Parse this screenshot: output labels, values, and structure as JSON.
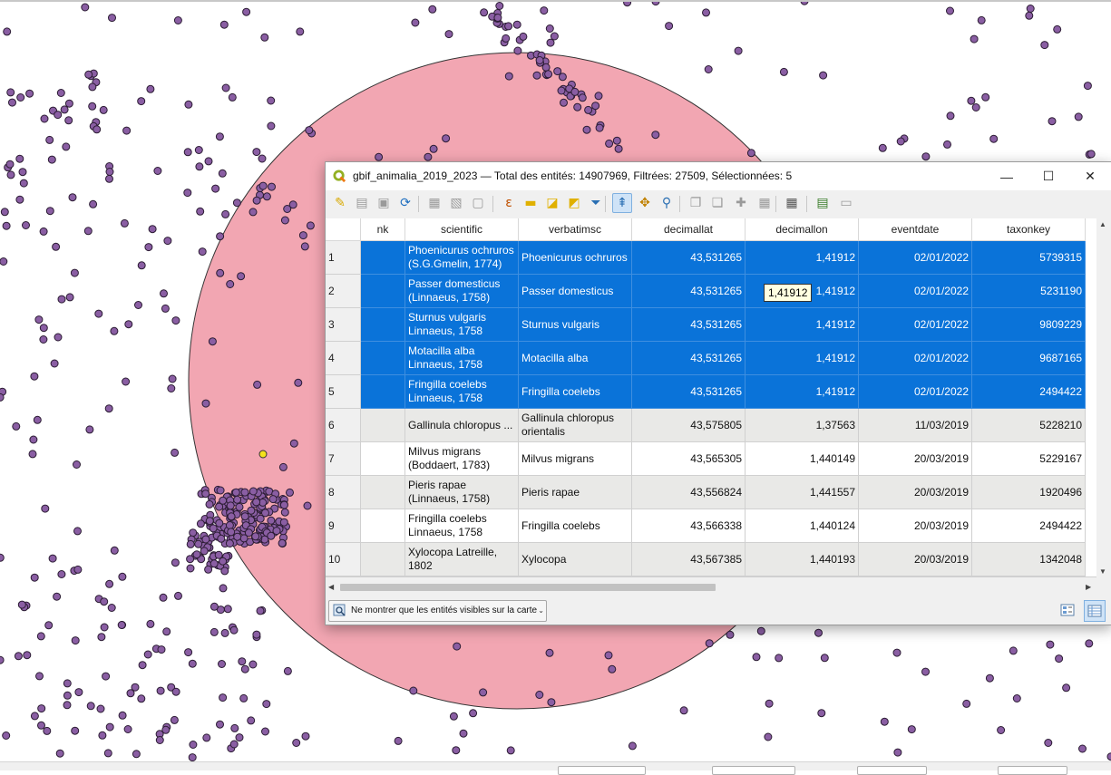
{
  "window": {
    "title": "gbif_animalia_2019_2023 — Total des entités: 14907969, Filtrées: 27509, Sélectionnées: 5",
    "minimize": "—",
    "maximize": "☐",
    "close": "✕"
  },
  "colors": {
    "selection": "#0a73d9",
    "alt_row": "#e9e9e7",
    "buffer_fill": "#f2a6b2",
    "point_fill": "#8a5ea3",
    "highlight_point": "#f4e21c"
  },
  "toolbar": {
    "items": [
      "pencil-icon",
      "toggle-multi-edit-icon",
      "save-edits-icon",
      "reload-icon",
      "add-feature-icon",
      "delete-feature-icon",
      "cut-icon",
      "expression-select-icon",
      "select-all-icon",
      "invert-selection-icon",
      "deselect-icon",
      "filter-icon",
      "move-selection-top-icon",
      "pan-to-selection-icon",
      "zoom-to-selection-icon",
      "copy-icon",
      "paste-icon",
      "new-field-icon",
      "delete-field-icon",
      "field-calculator-icon",
      "conditional-format-icon",
      "dock-icon",
      "actions-icon"
    ]
  },
  "table": {
    "columns": [
      "nk",
      "scientific",
      "verbatimsc",
      "decimallat",
      "decimallon",
      "eventdate",
      "taxonkey"
    ],
    "rows": [
      {
        "n": "1",
        "nk": "",
        "scientific": "Phoenicurus ochruros (S.G.Gmelin, 1774)",
        "verbatimsc": "Phoenicurus ochruros",
        "decimallat": "43,531265",
        "decimallon": "1,41912",
        "eventdate": "02/01/2022",
        "taxonkey": "5739315",
        "selected": true
      },
      {
        "n": "2",
        "nk": "",
        "scientific": "Passer domesticus (Linnaeus, 1758)",
        "verbatimsc": "Passer domesticus",
        "decimallat": "43,531265",
        "decimallon": "1,41912",
        "eventdate": "02/01/2022",
        "taxonkey": "5231190",
        "selected": true
      },
      {
        "n": "3",
        "nk": "",
        "scientific": "Sturnus vulgaris Linnaeus, 1758",
        "verbatimsc": "Sturnus vulgaris",
        "decimallat": "43,531265",
        "decimallon": "1,41912",
        "eventdate": "02/01/2022",
        "taxonkey": "9809229",
        "selected": true
      },
      {
        "n": "4",
        "nk": "",
        "scientific": "Motacilla alba Linnaeus, 1758",
        "verbatimsc": "Motacilla alba",
        "decimallat": "43,531265",
        "decimallon": "1,41912",
        "eventdate": "02/01/2022",
        "taxonkey": "9687165",
        "selected": true
      },
      {
        "n": "5",
        "nk": "",
        "scientific": "Fringilla coelebs Linnaeus, 1758",
        "verbatimsc": "Fringilla coelebs",
        "decimallat": "43,531265",
        "decimallon": "1,41912",
        "eventdate": "02/01/2022",
        "taxonkey": "2494422",
        "selected": true
      },
      {
        "n": "6",
        "nk": "",
        "scientific": "Gallinula chloropus ...",
        "verbatimsc": "Gallinula chloropus orientalis",
        "decimallat": "43,575805",
        "decimallon": "1,37563",
        "eventdate": "11/03/2019",
        "taxonkey": "5228210",
        "selected": false
      },
      {
        "n": "7",
        "nk": "",
        "scientific": "Milvus migrans (Boddaert, 1783)",
        "verbatimsc": "Milvus migrans",
        "decimallat": "43,565305",
        "decimallon": "1,440149",
        "eventdate": "20/03/2019",
        "taxonkey": "5229167",
        "selected": false
      },
      {
        "n": "8",
        "nk": "",
        "scientific": "Pieris rapae (Linnaeus, 1758)",
        "verbatimsc": "Pieris rapae",
        "decimallat": "43,556824",
        "decimallon": "1,441557",
        "eventdate": "20/03/2019",
        "taxonkey": "1920496",
        "selected": false
      },
      {
        "n": "9",
        "nk": "",
        "scientific": "Fringilla coelebs Linnaeus, 1758",
        "verbatimsc": "Fringilla coelebs",
        "decimallat": "43,566338",
        "decimallon": "1,440124",
        "eventdate": "20/03/2019",
        "taxonkey": "2494422",
        "selected": false
      },
      {
        "n": "10",
        "nk": "",
        "scientific": "Xylocopa Latreille, 1802",
        "verbatimsc": "Xylocopa",
        "decimallat": "43,567385",
        "decimallon": "1,440193",
        "eventdate": "20/03/2019",
        "taxonkey": "1342048",
        "selected": false
      }
    ],
    "tooltip": "1,41912"
  },
  "bottom": {
    "filter_label": "Ne montrer que les entités visibles sur la carte"
  }
}
